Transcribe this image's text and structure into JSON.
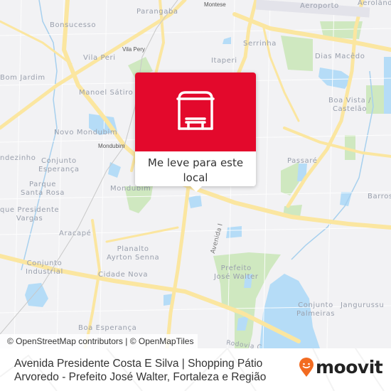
{
  "map": {
    "labels": {
      "parangaba": "Parangaba",
      "montese": "Montese",
      "aeroporto": "Aeroporto",
      "aerolandia": "Aerolândia",
      "bonsucesso": "Bonsucesso",
      "vila_pery": "Vila Pery",
      "vila_peri": "Vila Peri",
      "serrinha": "Serrinha",
      "itaperi": "Itaperi",
      "dias_macedo": "Dias Macêdo",
      "bom_jardim": "Bom Jardim",
      "manoel_satiro": "Manoel Sátiro",
      "boa_vista_1": "Boa Vista /",
      "boa_vista_2": "Castelão",
      "novo_mondubim": "Novo Mondubim",
      "mondubim_station": "Mondubim",
      "canindezinho": "ndezinho",
      "conjunto_esperanca_1": "Conjunto",
      "conjunto_esperanca_2": "Esperança",
      "passare": "Passaré",
      "parque_santa_rosa_1": "Parque",
      "parque_santa_rosa_2": "Santa Rosa",
      "mondubim": "Mondubim",
      "barroso": "Barros",
      "parque_pres_vargas_1": "que Presidente",
      "parque_pres_vargas_2": "Vargas",
      "aracape": "Aracapé",
      "avenida_i": "Avenida I",
      "planalto_1": "Planalto",
      "planalto_2": "Ayrton Senna",
      "conjunto_industrial_1": "Conjunto",
      "conjunto_industrial_2": "Industrial",
      "cidade_nova": "Cidade Nova",
      "prefeito_1": "Prefeito",
      "prefeito_2": "José Walter",
      "conjunto_palmeiras_1": "Conjunto",
      "conjunto_palmeiras_2": "Palmeiras",
      "jangurussu": "Jangurussu",
      "boa_esperanca": "Boa Esperança",
      "rodovia": "Rodovia C"
    },
    "attribution": "© OpenStreetMap contributors | © OpenMapTiles"
  },
  "popup": {
    "icon": "bus-stop-icon",
    "action_label": "Me leve para este local",
    "color": "#e3092c"
  },
  "footer": {
    "title": "Avenida Presidente Costa E Silva | Shopping Pátio Arvoredo - Prefeito José Walter, Fortaleza e Região",
    "logo_text": "moovit",
    "logo_color": "#f26b21"
  }
}
